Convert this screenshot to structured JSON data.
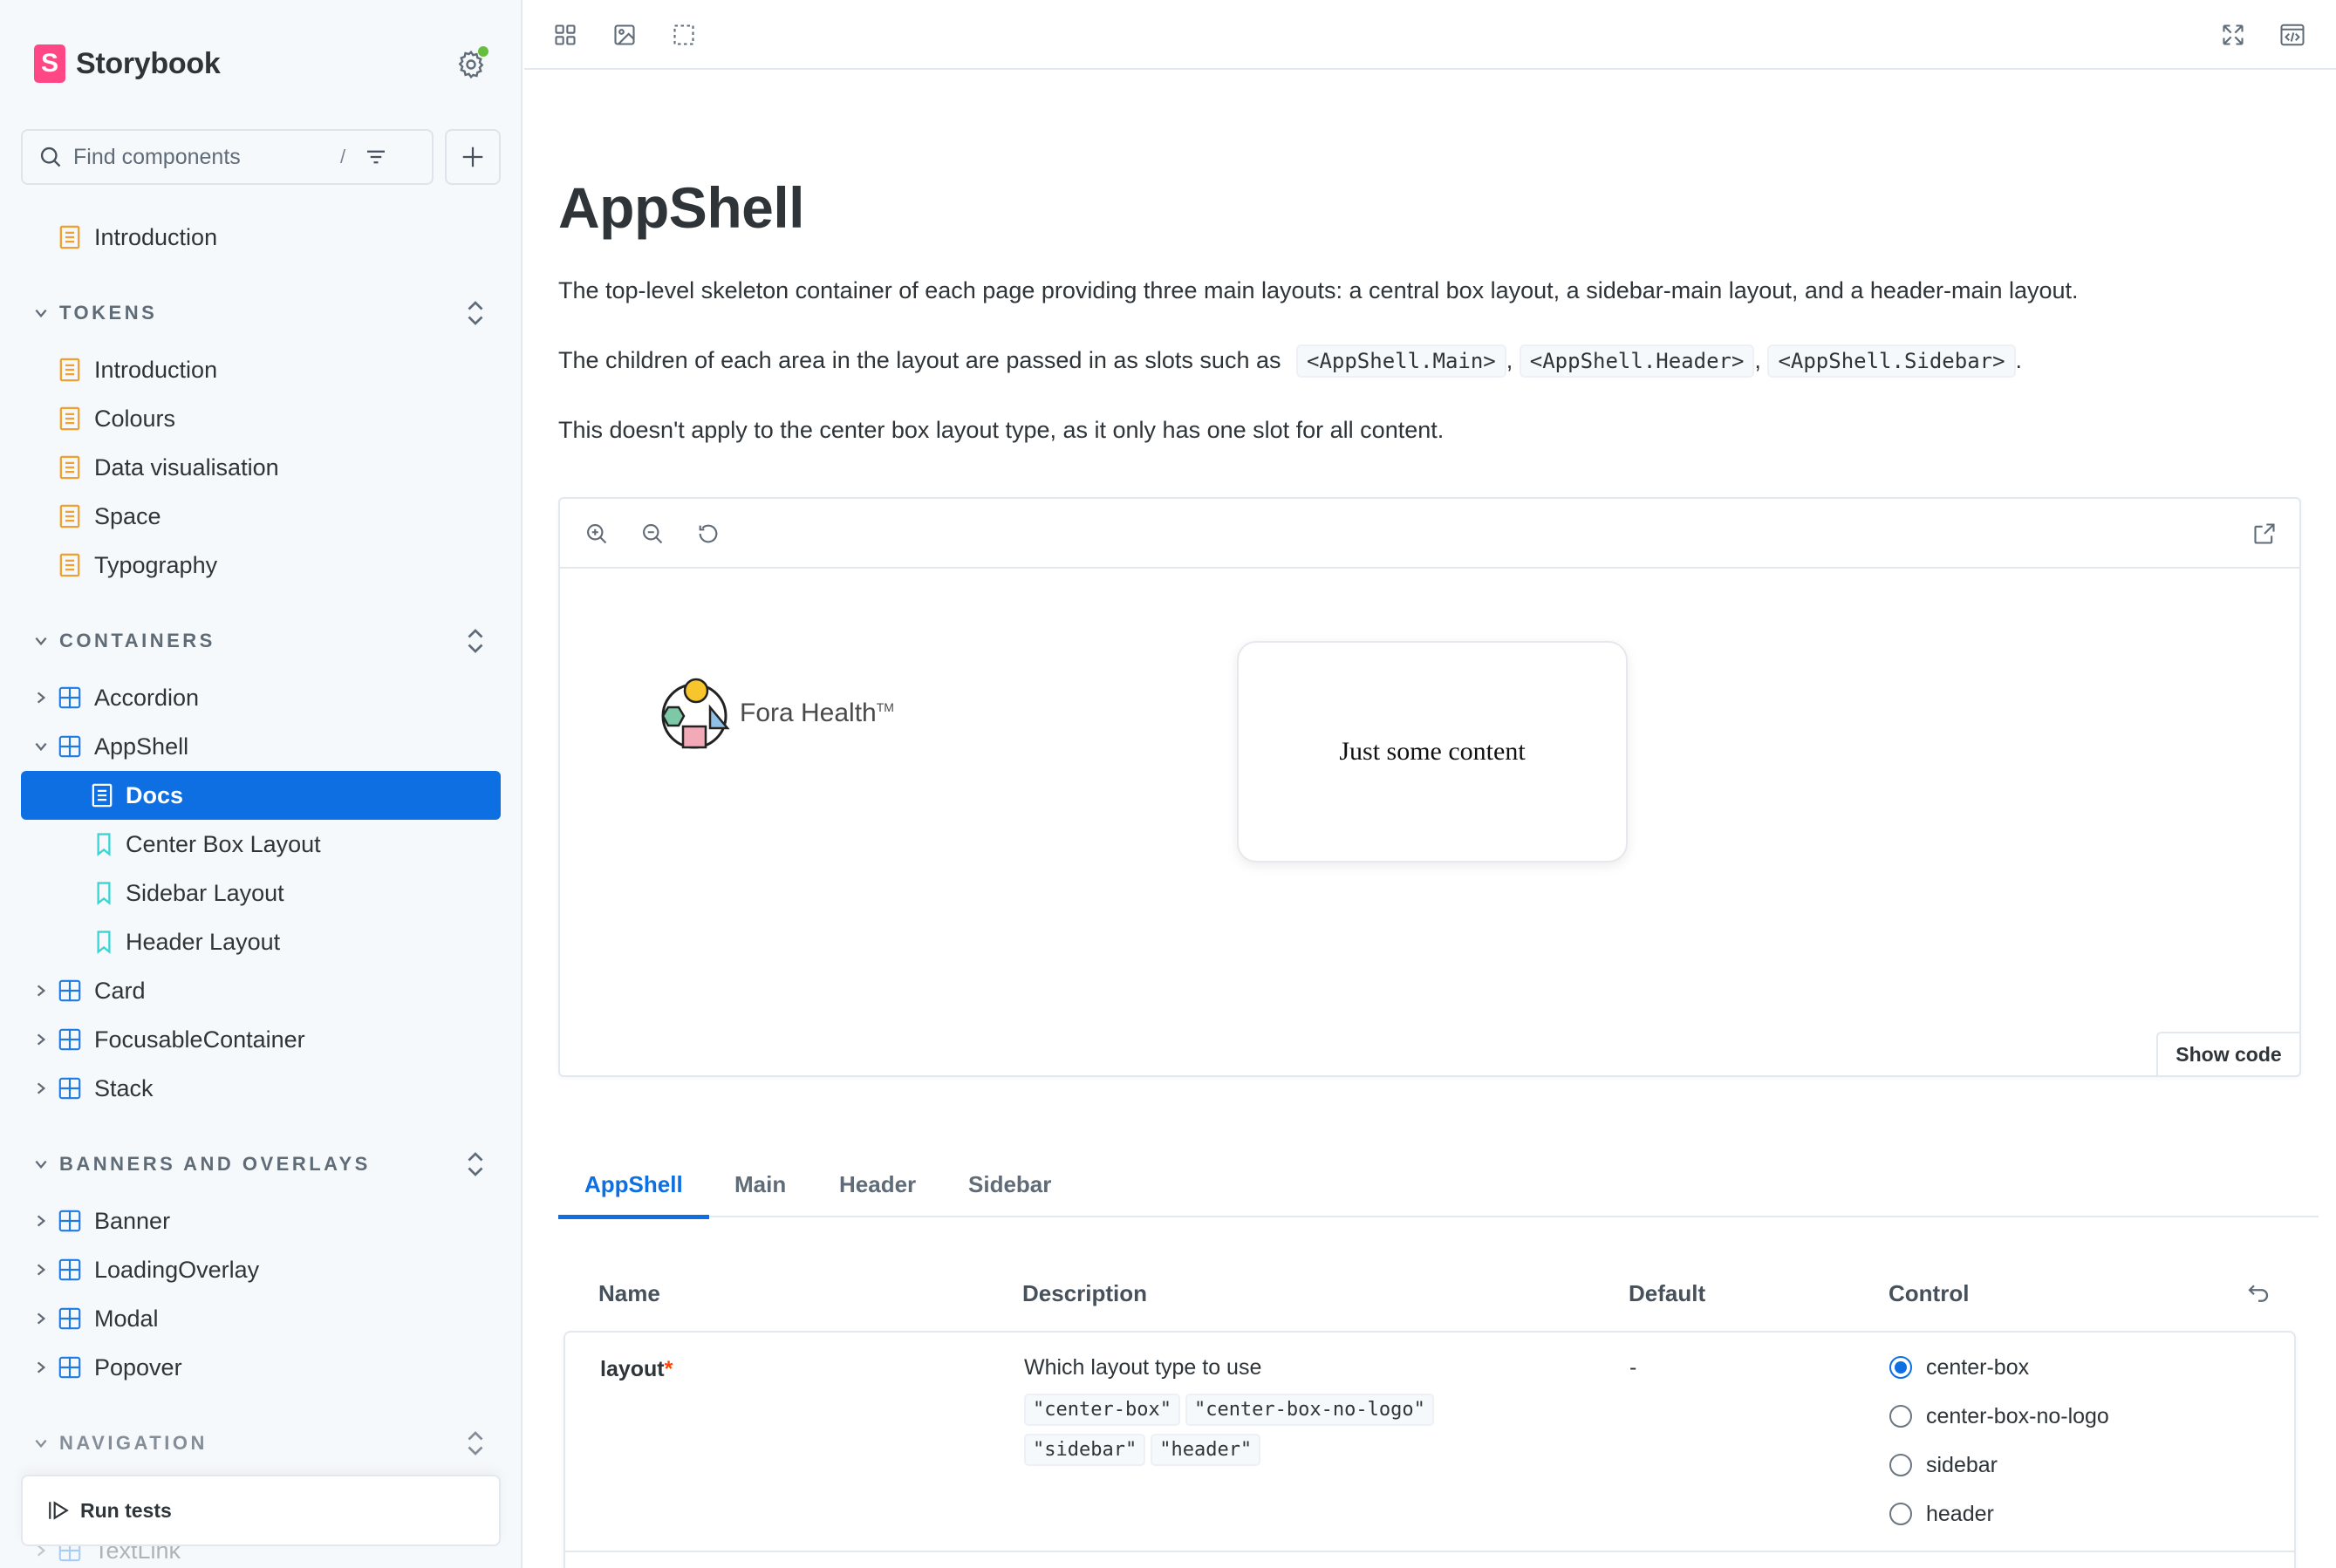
{
  "brand": {
    "name": "Storybook",
    "logo_letter": "S"
  },
  "search": {
    "placeholder": "Find components",
    "shortcut": "/"
  },
  "sidebar": {
    "top_item": "Introduction",
    "sections": [
      {
        "title": "TOKENS",
        "items": [
          "Introduction",
          "Colours",
          "Data visualisation",
          "Space",
          "Typography"
        ]
      },
      {
        "title": "CONTAINERS",
        "items": [
          "Accordion",
          "AppShell",
          "Card",
          "FocusableContainer",
          "Stack"
        ]
      },
      {
        "title": "BANNERS AND OVERLAYS",
        "items": [
          "Banner",
          "LoadingOverlay",
          "Modal",
          "Popover"
        ]
      },
      {
        "title": "NAVIGATION",
        "items": [
          "TextLink"
        ]
      }
    ],
    "appshell_children": [
      "Docs",
      "Center Box Layout",
      "Sidebar Layout",
      "Header Layout"
    ],
    "active_item": "Docs",
    "run_tests": "Run tests"
  },
  "doc": {
    "title": "AppShell",
    "para1": "The top-level skeleton container of each page providing three main layouts: a central box layout, a sidebar-main layout, and a header-main layout.",
    "para2_prefix": "The children of each area in the layout are passed in as slots such as",
    "para2_codes": [
      "<AppShell.Main>",
      "<AppShell.Header>",
      "<AppShell.Sidebar>"
    ],
    "para2_seps": [
      ",",
      ",",
      "."
    ],
    "para3": "This doesn't apply to the center box layout type, as it only has one slot for all content."
  },
  "preview": {
    "logo_text": "Fora Health",
    "logo_tm": "TM",
    "card_text": "Just some content",
    "show_code": "Show code"
  },
  "tabs": [
    "AppShell",
    "Main",
    "Header",
    "Sidebar"
  ],
  "active_tab": "AppShell",
  "args_table": {
    "headers": {
      "name": "Name",
      "description": "Description",
      "default": "Default",
      "control": "Control"
    },
    "rows": [
      {
        "name": "layout",
        "required_mark": "*",
        "description": "Which layout type to use",
        "type_values": [
          "\"center-box\"",
          "\"center-box-no-logo\"",
          "\"sidebar\"",
          "\"header\""
        ],
        "default": "-",
        "control_options": [
          "center-box",
          "center-box-no-logo",
          "sidebar",
          "header"
        ],
        "control_selected": "center-box"
      }
    ]
  },
  "colors": {
    "accent": "#0d6fe1",
    "brand": "#ff4785",
    "sidebar_bg": "#f6f9fc",
    "status_dot": "#66bf3c",
    "doc_icon": "#f0a030",
    "component_icon": "#1f7ae0",
    "story_icon": "#37d5d3"
  }
}
